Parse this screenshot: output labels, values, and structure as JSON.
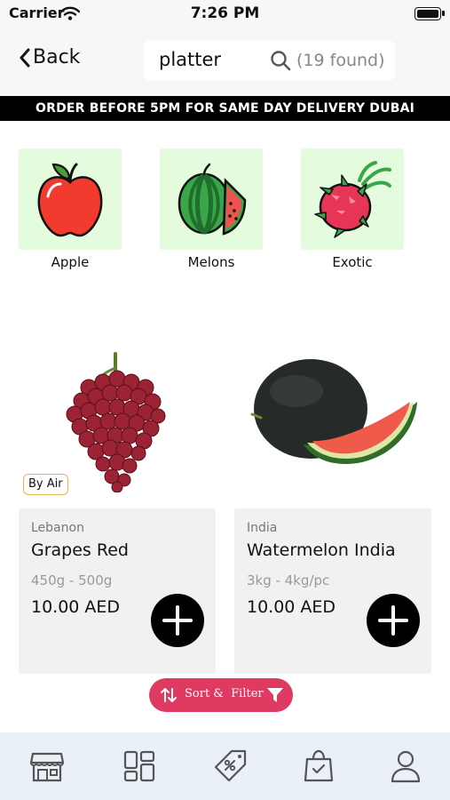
{
  "status_bar": {
    "carrier": "Carrier",
    "time": "7:26 PM"
  },
  "header": {
    "back_label": "Back",
    "search": {
      "query": "platter",
      "result_count": "(19 found)"
    }
  },
  "banner": {
    "text": "ORDER BEFORE 5PM FOR SAME DAY DELIVERY DUBAI"
  },
  "categories": [
    {
      "label": "Apple",
      "icon": "apple-icon"
    },
    {
      "label": "Melons",
      "icon": "watermelon-icon"
    },
    {
      "label": "Exotic",
      "icon": "dragonfruit-icon"
    }
  ],
  "products": [
    {
      "badge": "By Air",
      "origin": "Lebanon",
      "name": "Grapes Red",
      "weight": "450g - 500g",
      "price": "10.00 AED"
    },
    {
      "badge": "",
      "origin": "India",
      "name": "Watermelon India",
      "weight": "3kg - 4kg/pc",
      "price": "10.00 AED"
    }
  ],
  "sort_filter": {
    "label": "Sort &  Filter"
  },
  "tabbar": {
    "items": [
      {
        "icon": "store-icon"
      },
      {
        "icon": "categories-icon"
      },
      {
        "icon": "offers-tag-icon"
      },
      {
        "icon": "shopping-bag-icon"
      },
      {
        "icon": "profile-icon"
      }
    ]
  },
  "colors": {
    "accent": "#df3a62",
    "category_tile": "#e5fbdd",
    "banner_bg": "#000000",
    "tabbar_bg": "#e9f0f8",
    "card_bg": "#f1f1f1",
    "badge_border": "#e8b54b"
  }
}
